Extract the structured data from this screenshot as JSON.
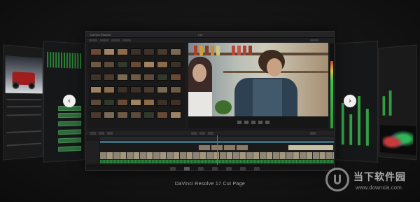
{
  "caption": "DaVinci Resolve 17 Cut Page",
  "carousel": {
    "prev_glyph": "‹",
    "next_glyph": "›",
    "prev_icon": "chevron-left-icon",
    "next_icon": "chevron-right-icon"
  },
  "watermark": {
    "title": "当下软件园",
    "url": "www.downxia.com"
  },
  "main_window": {
    "title_left": "DaVinci Resolve",
    "title_center": "Cut"
  },
  "colors": {
    "accent_green": "#30a043",
    "playhead_red": "#d34a3a",
    "timeline_teal": "#3a6d7d"
  }
}
